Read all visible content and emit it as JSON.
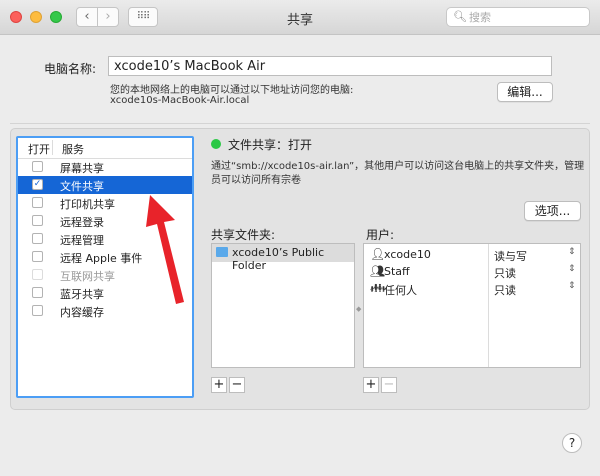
{
  "window": {
    "title": "共享"
  },
  "search": {
    "placeholder": "搜索"
  },
  "computer_name": {
    "label": "电脑名称:",
    "value": "xcode10’s MacBook Air",
    "description": "您的本地网络上的电脑可以通过以下地址访问您的电脑:",
    "address": "xcode10s-MacBook-Air.local",
    "edit_label": "编辑..."
  },
  "services": {
    "header_on": "打开",
    "header_service": "服务",
    "items": [
      {
        "label": "屏幕共享",
        "checked": false,
        "selected": false,
        "disabled": false
      },
      {
        "label": "文件共享",
        "checked": true,
        "selected": true,
        "disabled": false
      },
      {
        "label": "打印机共享",
        "checked": false,
        "selected": false,
        "disabled": false
      },
      {
        "label": "远程登录",
        "checked": false,
        "selected": false,
        "disabled": false
      },
      {
        "label": "远程管理",
        "checked": false,
        "selected": false,
        "disabled": false
      },
      {
        "label": "远程 Apple 事件",
        "checked": false,
        "selected": false,
        "disabled": false
      },
      {
        "label": "互联网共享",
        "checked": false,
        "selected": false,
        "disabled": true
      },
      {
        "label": "蓝牙共享",
        "checked": false,
        "selected": false,
        "disabled": false
      },
      {
        "label": "内容缓存",
        "checked": false,
        "selected": false,
        "disabled": false
      }
    ]
  },
  "status": {
    "text": "文件共享：打开",
    "color": "#2ac845",
    "description": "通过“smb://xcode10s-air.lan”，其他用户可以访问这台电脑上的共享文件夹，管理员可以访问所有宗卷"
  },
  "options_label": "选项...",
  "shared_folders": {
    "label": "共享文件夹:",
    "items": [
      {
        "name": "xcode10’s Public Folder"
      }
    ],
    "add": "+",
    "remove": "−"
  },
  "users": {
    "label": "用户:",
    "items": [
      {
        "name": "xcode10",
        "icon": "user-icon",
        "permission": "读与写"
      },
      {
        "name": "Staff",
        "icon": "group-icon",
        "permission": "只读"
      },
      {
        "name": "任何人",
        "icon": "everyone-icon",
        "permission": "只读"
      }
    ],
    "add": "+",
    "remove": "−"
  },
  "help_label": "?",
  "accent_color": "#1566d6",
  "annotation_color": "#e8232a"
}
